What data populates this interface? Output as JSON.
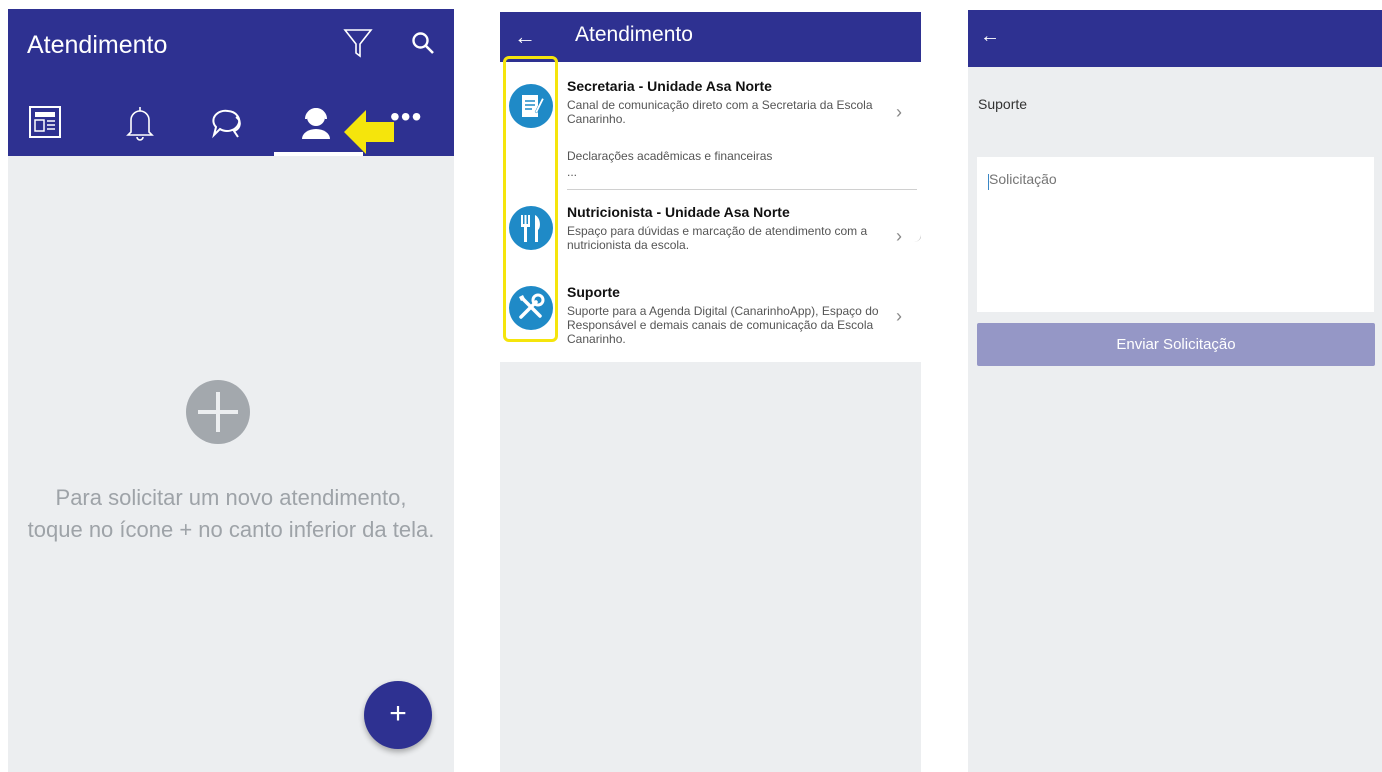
{
  "panel1": {
    "title": "Atendimento",
    "icons": [
      "filter-icon",
      "search-icon",
      "news-icon",
      "bell-icon",
      "chat-icon",
      "support-icon"
    ],
    "more_label": "•••",
    "empty_line1": "Para solicitar um novo atendimento,",
    "empty_line2": "toque no ícone + no canto inferior da tela.",
    "fab_label": "+",
    "accent": "#2e3191"
  },
  "panel2": {
    "back_label": "←",
    "title": "Atendimento",
    "items": [
      {
        "title": "Secretaria - Unidade Asa Norte",
        "desc": "Canal de comunicação direto com a Secretaria da Escola Canarinho.",
        "extra": "Declarações acadêmicas e financeiras",
        "extra2": "...",
        "icon": "document-edit-icon"
      },
      {
        "title": "Nutricionista - Unidade Asa Norte",
        "desc": "Espaço para dúvidas e marcação de atendimento com a nutricionista da escola.",
        "icon": "fork-knife-icon"
      },
      {
        "title": "Suporte",
        "desc": "Suporte para a Agenda Digital (CanarinhoApp), Espaço do Responsável e demais canais de comunicação da Escola Canarinho.",
        "icon": "tools-icon"
      }
    ],
    "chevron": "›",
    "icon_color": "#1f8ac7",
    "highlight_color": "#f5e50c"
  },
  "panel3": {
    "back_label": "←",
    "label": "Suporte",
    "placeholder": "Solicitação",
    "button_label": "Enviar Solicitação",
    "button_color": "#9597c6"
  }
}
